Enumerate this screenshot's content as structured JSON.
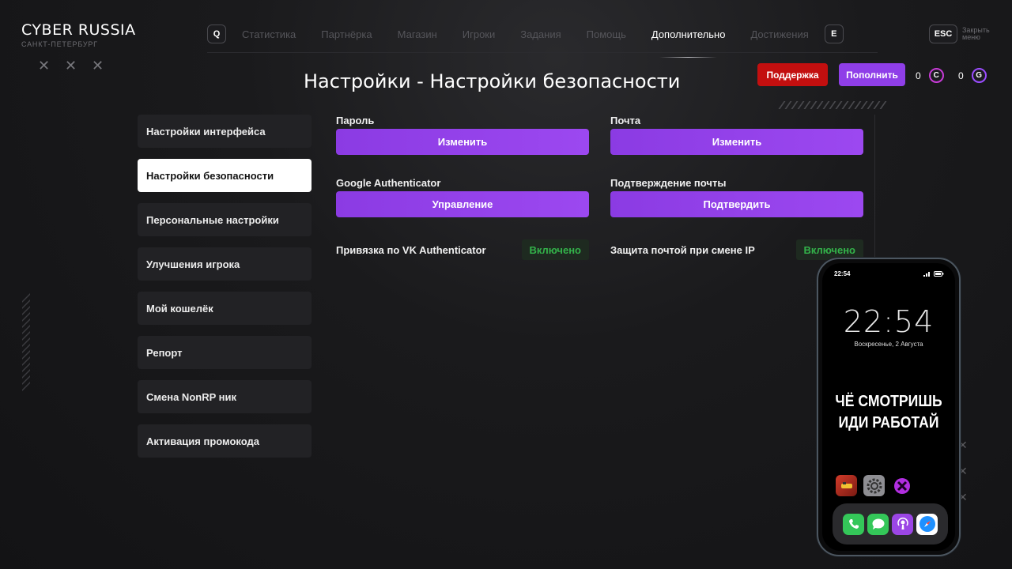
{
  "brand": {
    "name": "CYBER RUSSIA",
    "city": "САНКТ-ПЕТЕРБУРГ"
  },
  "crosses": [
    "✕",
    "✕",
    "✕"
  ],
  "nav": {
    "left_key": "Q",
    "right_key": "E",
    "items": [
      {
        "label": "Статистика",
        "active": false
      },
      {
        "label": "Партнёрка",
        "active": false
      },
      {
        "label": "Магазин",
        "active": false
      },
      {
        "label": "Игроки",
        "active": false
      },
      {
        "label": "Задания",
        "active": false
      },
      {
        "label": "Помощь",
        "active": false
      },
      {
        "label": "Дополнительно",
        "active": true
      },
      {
        "label": "Достижения",
        "active": false
      }
    ]
  },
  "esc": {
    "key": "ESC",
    "label": "Закрыть меню"
  },
  "title": "Настройки - Настройки безопасности",
  "header_buttons": {
    "support": "Поддержка",
    "topup": "Пополнить"
  },
  "currencies": [
    {
      "amount": "0",
      "symbol": "C"
    },
    {
      "amount": "0",
      "symbol": "G"
    }
  ],
  "sidebar": {
    "items": [
      {
        "label": "Настройки интерфейса"
      },
      {
        "label": "Настройки безопасности"
      },
      {
        "label": "Персональные настройки"
      },
      {
        "label": "Улучшения игрока"
      },
      {
        "label": "Мой кошелёк"
      },
      {
        "label": "Репорт"
      },
      {
        "label": "Смена NonRP ник"
      },
      {
        "label": "Активация промокода"
      }
    ]
  },
  "security": {
    "password": {
      "label": "Пароль",
      "button": "Изменить"
    },
    "email": {
      "label": "Почта",
      "button": "Изменить"
    },
    "google": {
      "label": "Google Authenticator",
      "button": "Управление"
    },
    "email_confirm": {
      "label": "Подтверждение почты",
      "button": "Подтвердить"
    },
    "vk": {
      "label": "Привязка по VK Authenticator",
      "state": "Включено"
    },
    "ip_protect": {
      "label": "Защита почтой при смене IP",
      "state": "Включено"
    }
  },
  "phone": {
    "status_time": "22:54",
    "clock": "22:54",
    "date": "Воскресенье, 2 Августа",
    "message_line1": "ЧЁ СМОТРИШЬ",
    "message_line2": "ИДИ РАБОТАЙ",
    "apps": [
      "game-app-icon",
      "settings-app-icon",
      "cyber-app-icon"
    ],
    "dock": [
      "phone-app-icon",
      "messages-app-icon",
      "podcasts-app-icon",
      "safari-app-icon"
    ]
  },
  "colors": {
    "accent": "#9c48f0",
    "support": "#c30f0f",
    "enabled": "#33b34a",
    "background": "#19191b"
  }
}
